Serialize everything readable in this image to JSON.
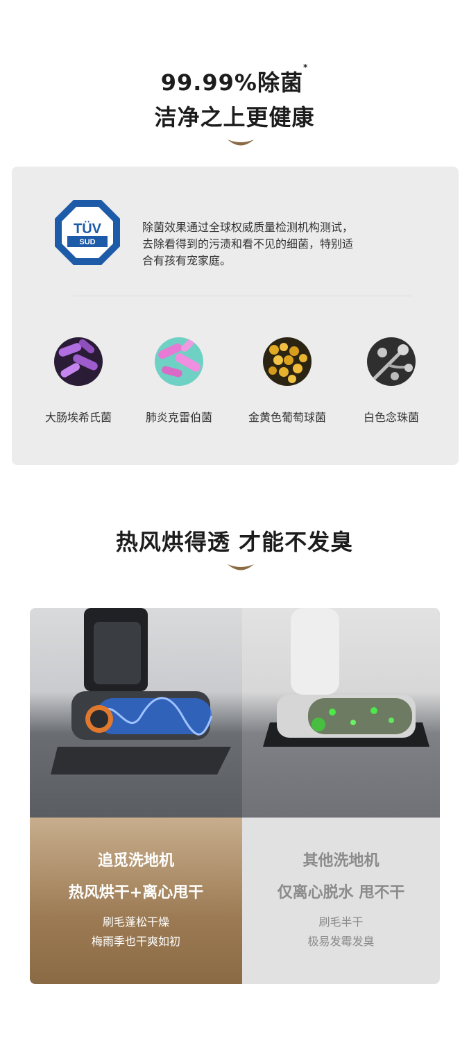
{
  "section1": {
    "title_main": "99.99%除菌",
    "title_sup": "*",
    "subtitle": "洁净之上更健康"
  },
  "tuv": {
    "logo_top": "TÜV",
    "logo_bottom": "SUD",
    "description_lines": [
      "除菌效果通过全球权威质量检测机构测试，",
      "去除看得到的污渍和看不见的细菌，特别适",
      "合有孩有宠家庭。"
    ]
  },
  "bacteria": [
    {
      "label": "大肠埃希氏菌",
      "color": "#a05cc7"
    },
    {
      "label": "肺炎克雷伯菌",
      "color": "#e37bd3"
    },
    {
      "label": "金黄色葡萄球菌",
      "color": "#d8a21d"
    },
    {
      "label": "白色念珠菌",
      "color": "#9a9a9a"
    }
  ],
  "section2": {
    "title": "热风烘得透 才能不发臭"
  },
  "compare": {
    "left": {
      "name": "追觅洗地机",
      "feature": "热风烘干+离心甩干",
      "lines": [
        "刷毛蓬松干燥",
        "梅雨季也干爽如初"
      ]
    },
    "right": {
      "name": "其他洗地机",
      "feature": "仅离心脱水 甩不干",
      "lines": [
        "刷毛半干",
        "极易发霉发臭"
      ]
    }
  },
  "colors": {
    "accent_gold": "#8a6a44",
    "tuv_blue": "#1d5aa8"
  }
}
